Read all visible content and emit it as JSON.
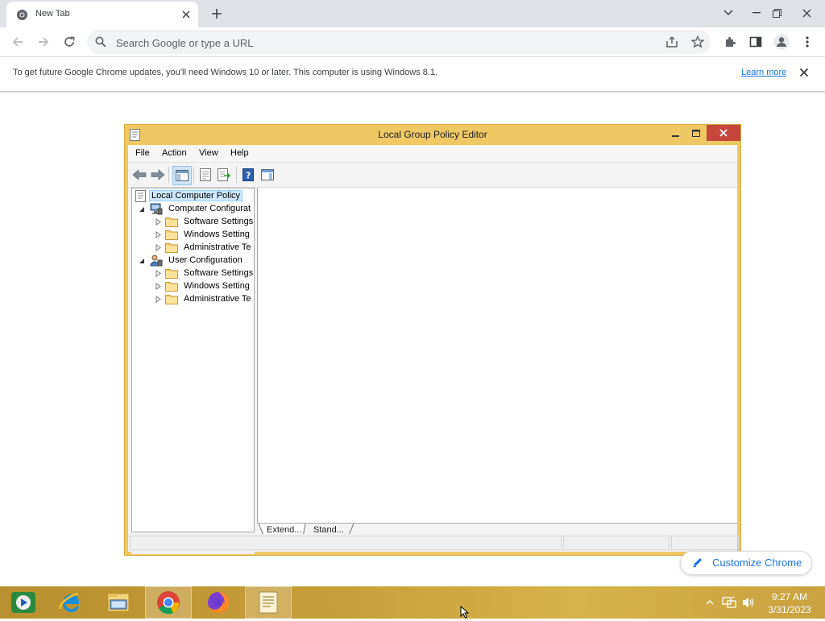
{
  "browser": {
    "tab_title": "New Tab",
    "omnibox_placeholder": "Search Google or type a URL",
    "accent": "#1a73e8"
  },
  "infobar": {
    "message": "To get future Google Chrome updates, you'll need Windows 10 or later. This computer is using Windows 8.1.",
    "link": "Learn more"
  },
  "mmc": {
    "title": "Local Group Policy Editor",
    "menu": [
      "File",
      "Action",
      "View",
      "Help"
    ],
    "tree": [
      {
        "label": "Local Computer Policy",
        "level": 0,
        "icon": "policy-doc-icon"
      },
      {
        "label": "Computer Configurat",
        "level": 1,
        "icon": "computer-config-icon"
      },
      {
        "label": "Software Settings",
        "level": 2,
        "icon": "folder-icon"
      },
      {
        "label": "Windows Setting",
        "level": 2,
        "icon": "folder-icon"
      },
      {
        "label": "Administrative Te",
        "level": 2,
        "icon": "folder-icon"
      },
      {
        "label": "User Configuration",
        "level": 1,
        "icon": "user-config-icon"
      },
      {
        "label": "Software Settings",
        "level": 2,
        "icon": "folder-icon"
      },
      {
        "label": "Windows Setting",
        "level": 2,
        "icon": "folder-icon"
      },
      {
        "label": "Administrative Te",
        "level": 2,
        "icon": "folder-icon"
      }
    ],
    "view_tabs": [
      "Extend...",
      "Stand..."
    ],
    "frame_color": "#efc864"
  },
  "customize": {
    "label": "Customize Chrome"
  },
  "taskbar": {
    "apps": [
      "media-center-icon",
      "internet-explorer-icon",
      "file-explorer-icon",
      "chrome-icon",
      "firefox-icon",
      "group-policy-icon"
    ],
    "time": "9:27 AM",
    "date": "3/31/2023"
  }
}
